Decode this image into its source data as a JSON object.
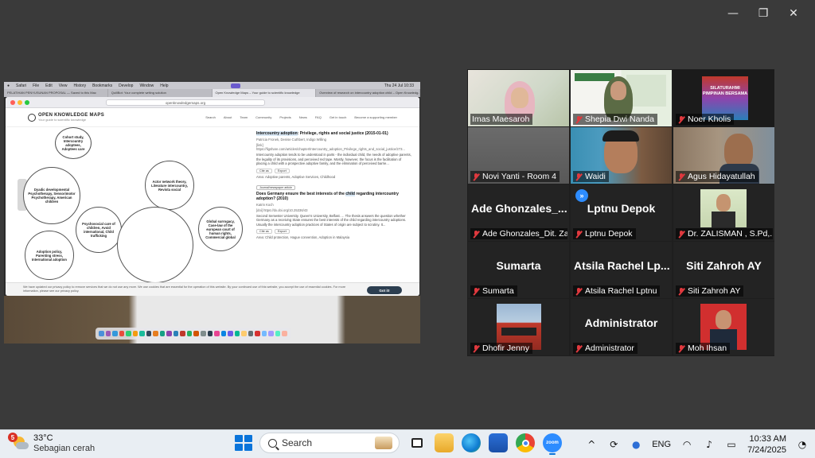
{
  "window": {
    "controls": {
      "minimize": "—",
      "restore": "❐",
      "close": "✕"
    }
  },
  "shared_screen": {
    "mac_menubar": [
      "Safari",
      "File",
      "Edit",
      "View",
      "History",
      "Bookmarks",
      "Develop",
      "Window",
      "Help"
    ],
    "mac_menubar_right": "Thu 24 Jul 10:33",
    "safari_tabs": [
      "PELATIHAN PENYUSUNAN PROPOSAL — Saved to this Mac",
      "QuillBot: Your complete writing solution",
      "Open Knowledge Maps – Your guide to scientific knowledge",
      "Overview of research on intercountry adoption child – Open Knowledg..."
    ],
    "url": "openknowledgemaps.org",
    "okm": {
      "title": "OPEN KNOWLEDGE MAPS",
      "subtitle": "Your guide to scientific knowledge",
      "nav": [
        "Search",
        "About",
        "Team",
        "Community",
        "Projects",
        "News",
        "FAQ",
        "Get in touch",
        "Become a supporting member"
      ]
    },
    "bubbles": [
      "Cohort study, Intercountry adoptees, Adoptees care",
      "Dyadic developmental Psychotherapy, Sensorimotor Psychotherapy, American children",
      "Actor network theory, Literature intercountry, Revista social",
      "Psychosocial care of children, Avoid international, Child trafficking",
      "Global surrogacy, Case-law of the european court of human rights, Commercial global",
      "Adoption policy, Parenting stress, International adoption"
    ],
    "results": [
      {
        "title_pre": "",
        "title_hl": "Intercountry adoption",
        "title_post": ": Privilege, rights and social justice (2015-01-01)",
        "meta": "Patricia Fronek, Denise Cuthbert, Indigo Willing",
        "link": "[link] https://figshare.com/articles/chapter/Intercountry_adoption_Privilege_rights_and_social_justice/273...",
        "text": "Intercountry adoption tends to be understood in parts - the individual child, the needs of adoptive parents, the legality of its provisions, and perceived red tape. Mostly, however, the focus is the facilitation of placing a child with a prospective adoptive family, and the elimination of perceived barrie...",
        "buttons": [
          "Cite as",
          "Export"
        ],
        "area": "Area: Adoptive parents, Adoptive Services, Childhood"
      },
      {
        "tag": "Journal/newspaper article",
        "title_pre": "Does Germany ensure the best interests of the ",
        "title_hl": "child",
        "title_post": " regarding intercountry adoption? (2010)",
        "meta": "Katrin Koch",
        "link": "[doi] https://dx.doi.org/10.25336/43",
        "text": "Second Semester University. Queen's University, Belfast. ... The thesis answers the question whether Germany as a receiving State ensures the best interests of the child regarding intercountry adoptions. Usually the intercountry adoption practices of States of origin are subject to scrutiny. It...",
        "buttons": [
          "Cite as",
          "Export"
        ],
        "area": "Area: Child protection, Hague convention, Adoption in Malaysia"
      }
    ],
    "cookie": {
      "text": "We have updated our privacy policy to remove services that we do not use any more. We use cookies that are essential for the operation of this website. By your continued use of this website, you accept the use of essential cookies. For more information, please see our privacy policy.",
      "button": "Got it!"
    }
  },
  "gallery": {
    "participants": [
      {
        "name": "Imas Maesaroh",
        "muted": false,
        "active": true
      },
      {
        "name": "Shepia Dwi Nanda",
        "muted": true
      },
      {
        "name": "Noer Kholis",
        "muted": true
      },
      {
        "name": "Novi Yanti - Room 4",
        "muted": true
      },
      {
        "name": "Waidi",
        "muted": true
      },
      {
        "name": "Agus Hidayatullah",
        "muted": true
      },
      {
        "name": "Ade Ghonzales_Dit. Za...",
        "big": "Ade  Ghonzales_...",
        "muted": true
      },
      {
        "name": "Lptnu Depok",
        "big": "Lptnu Depok",
        "muted": true
      },
      {
        "name": "Dr. ZALISMAN , S.Pd,...",
        "muted": true
      },
      {
        "name": "Sumarta",
        "big": "Sumarta",
        "muted": true
      },
      {
        "name": "Atsila Rachel Lptnu",
        "big": "Atsila  Rachel  Lp...",
        "muted": true
      },
      {
        "name": "Siti Zahroh AY",
        "big": "Siti  Zahroh  AY",
        "muted": true
      },
      {
        "name": "Dhofir Jenny",
        "muted": true
      },
      {
        "name": "Administrator",
        "big": "Administrator",
        "muted": true
      },
      {
        "name": "Moh Ihsan",
        "muted": true
      }
    ],
    "noer_banner": "SILATURAHMI PIMPINAN BERSAMA"
  },
  "taskbar": {
    "weather_badge": "5",
    "temp": "33°C",
    "weather_desc": "Sebagian cerah",
    "search_label": "Search",
    "language": "ENG",
    "time": "10:33 AM",
    "date": "7/24/2025"
  }
}
